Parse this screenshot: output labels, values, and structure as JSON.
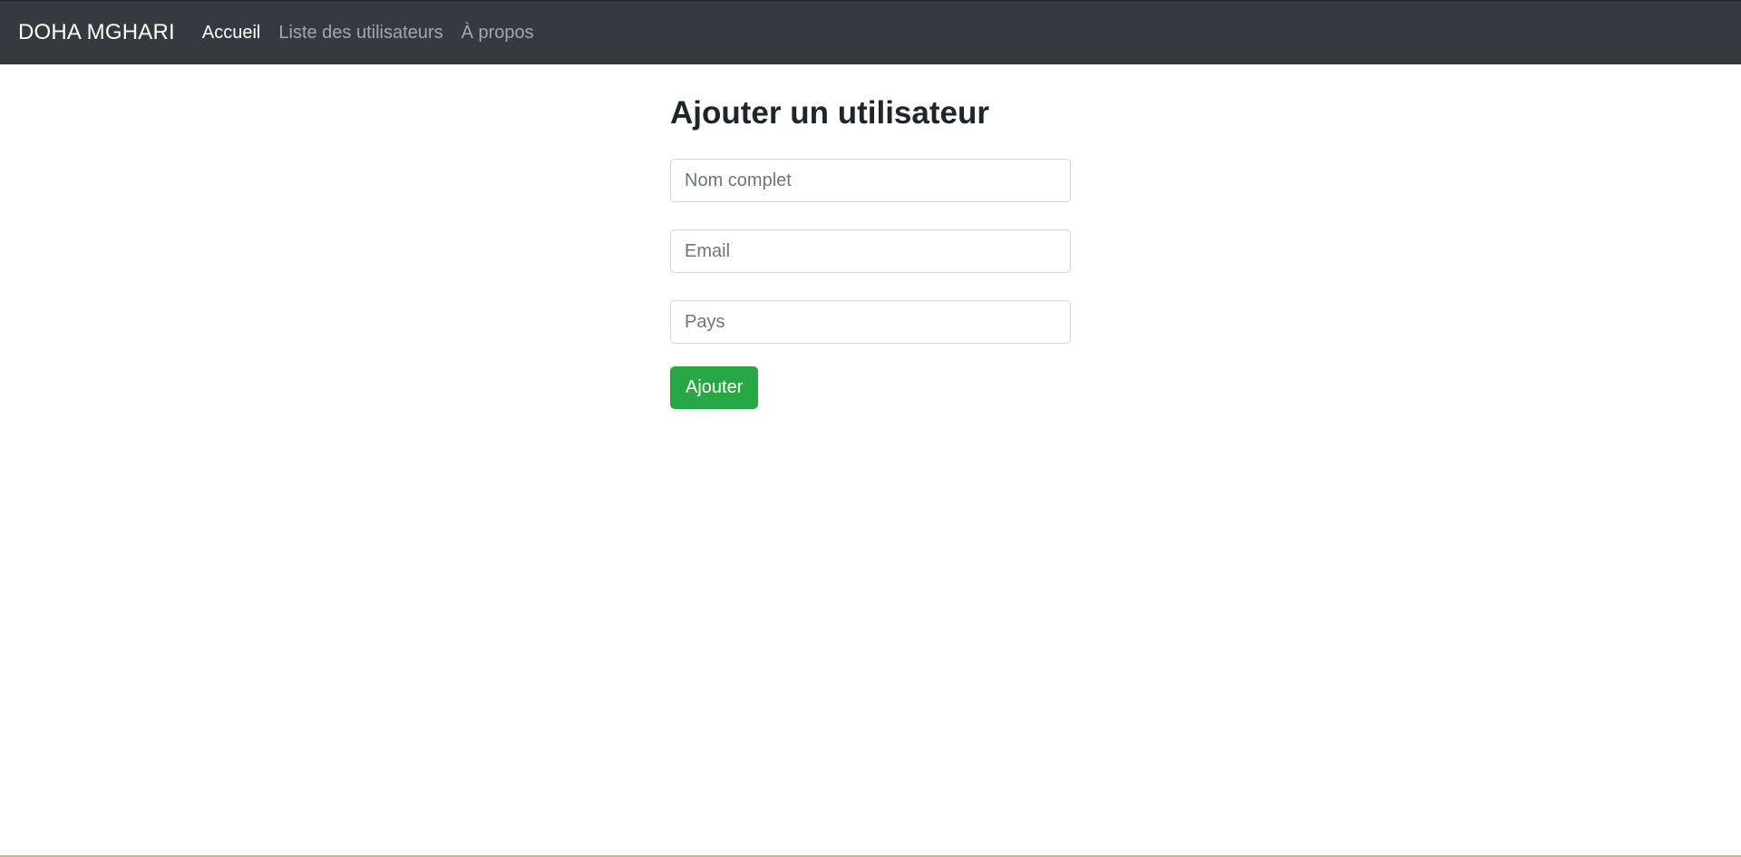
{
  "navbar": {
    "brand": "DOHA MGHARI",
    "links": [
      {
        "label": "Accueil"
      },
      {
        "label": "Liste des utilisateurs"
      },
      {
        "label": "À propos"
      }
    ]
  },
  "main": {
    "title": "Ajouter un utilisateur",
    "form": {
      "fields": [
        {
          "placeholder": "Nom complet",
          "value": ""
        },
        {
          "placeholder": "Email",
          "value": ""
        },
        {
          "placeholder": "Pays",
          "value": ""
        }
      ],
      "submit_label": "Ajouter"
    }
  },
  "colors": {
    "navbar_bg": "#343a40",
    "submit_bg": "#28a745"
  }
}
